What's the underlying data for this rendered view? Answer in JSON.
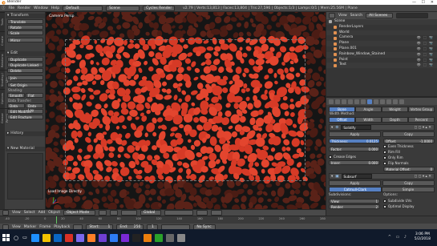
{
  "window": {
    "title": "Blender",
    "controls": [
      "—",
      "☐",
      "✕"
    ]
  },
  "infobar": {
    "menus": [
      "File",
      "Render",
      "Window",
      "Help"
    ],
    "layout": "Default",
    "scene": "Scene",
    "engine": "Cycles Render",
    "stats": "v2.79 | Verts:13,813 | Faces:13,804 | Tris:27,596 | Objects:1/3 | Lamps:0/1 | Mem:25.56M | Plane"
  },
  "toolshelf": {
    "tabs": [
      "Tools",
      "Create",
      "Relations",
      "Shading / UVs",
      "Options",
      "Grease Pencil"
    ],
    "transform_title": "Transform",
    "transform_buttons": [
      "Translate",
      "Rotate",
      "Scale",
      "Mirror"
    ],
    "edit_title": "Edit",
    "edit_buttons": [
      "Duplicate",
      "Duplicate Linked",
      "Delete",
      "Join"
    ],
    "set_origin": "Set Origin",
    "shading_label": "Shading:",
    "shading_buttons": [
      "Smooth",
      "Flat"
    ],
    "datatransfer_label": "Data Transfer:",
    "data_buttons": [
      "Data",
      "Data Lay"
    ],
    "edit2_buttons": [
      "Edit Modifier",
      "Edit Fracture"
    ],
    "history_title": "History",
    "material_title": "New Material"
  },
  "viewport": {
    "label": "Camera Persp",
    "operator_label": "Load Image Directly",
    "footer_menus": [
      "View",
      "Select",
      "Add",
      "Object"
    ],
    "mode": "Object Mode",
    "pivot": "Global"
  },
  "outliner": {
    "menus": [
      "View",
      "Search"
    ],
    "filter": "All Scenes",
    "items": [
      {
        "indent": 0,
        "label": "Scene"
      },
      {
        "indent": 1,
        "label": "RenderLayers"
      },
      {
        "indent": 1,
        "label": "World"
      },
      {
        "indent": 1,
        "label": "Camera"
      },
      {
        "indent": 1,
        "label": "Plane"
      },
      {
        "indent": 1,
        "label": "Plane.001"
      },
      {
        "indent": 1,
        "label": "Rainbow_Window_Stained"
      },
      {
        "indent": 1,
        "label": "Point"
      },
      {
        "indent": 1,
        "label": "Text"
      }
    ]
  },
  "properties": {
    "top_tabs": [
      "Bone",
      "Angle",
      "Weight",
      "Vertex Group"
    ],
    "width_label": "Width Method:",
    "width_tabs": [
      "Offset",
      "Width",
      "Depth",
      "Percent"
    ],
    "mod1_name": "Solidify",
    "mod1_buttons": [
      "Apply",
      "Copy"
    ],
    "thickness_label": "Thickness:",
    "thickness_value": "0.0125",
    "factor_label": "Factor:",
    "factor_value": "0.000",
    "crease_label": "Crease Edges",
    "inner_label": "Inner:",
    "inner_value": "0.000",
    "offset_label": "Offset:",
    "offset_value": "-1.0000",
    "checks": [
      "Even Thickness",
      "Rim Fill",
      "Only Rim",
      "Flip Normals"
    ],
    "material_offset": "Material Offset:",
    "mod2_name": "Subsurf",
    "mod2_buttons": [
      "Apply",
      "Copy"
    ],
    "subsurf_tabs": [
      "Catmull-Clark",
      "Simple"
    ],
    "subdivisions_label": "Subdivisions:",
    "view_label": "View:",
    "view_value": "1",
    "render_label": "Render:",
    "render_value": "2",
    "options_label": "Options:",
    "opt_checks": [
      "Subdivide UVs",
      "Optimal Display"
    ]
  },
  "timeline": {
    "numbers": [
      "-40",
      "-20",
      "0",
      "20",
      "40",
      "60",
      "80",
      "100",
      "120",
      "140",
      "160",
      "180",
      "200",
      "220",
      "240",
      "260",
      "280"
    ],
    "menus": [
      "View",
      "Marker",
      "Frame",
      "Playback"
    ],
    "start_label": "Start:",
    "start": "1",
    "end_label": "End:",
    "end": "250",
    "current": "1",
    "sync": "No Sync"
  },
  "taskbar": {
    "time": "3:06 PM",
    "date": "5/2/2018",
    "icons": [
      "#1e90ff",
      "#f2c200",
      "#0a66c2",
      "#d93025",
      "#7b68ee",
      "#ff7f27",
      "#6f3fd4",
      "#2d7cf6",
      "#7a2ad6",
      "#222222",
      "#e87d0d",
      "#2aa12a",
      "#666666",
      "#888888"
    ]
  },
  "colors": {
    "accent": "#5680c2",
    "blender_orange": "#e87d0d",
    "background_red": "#e0442c"
  }
}
